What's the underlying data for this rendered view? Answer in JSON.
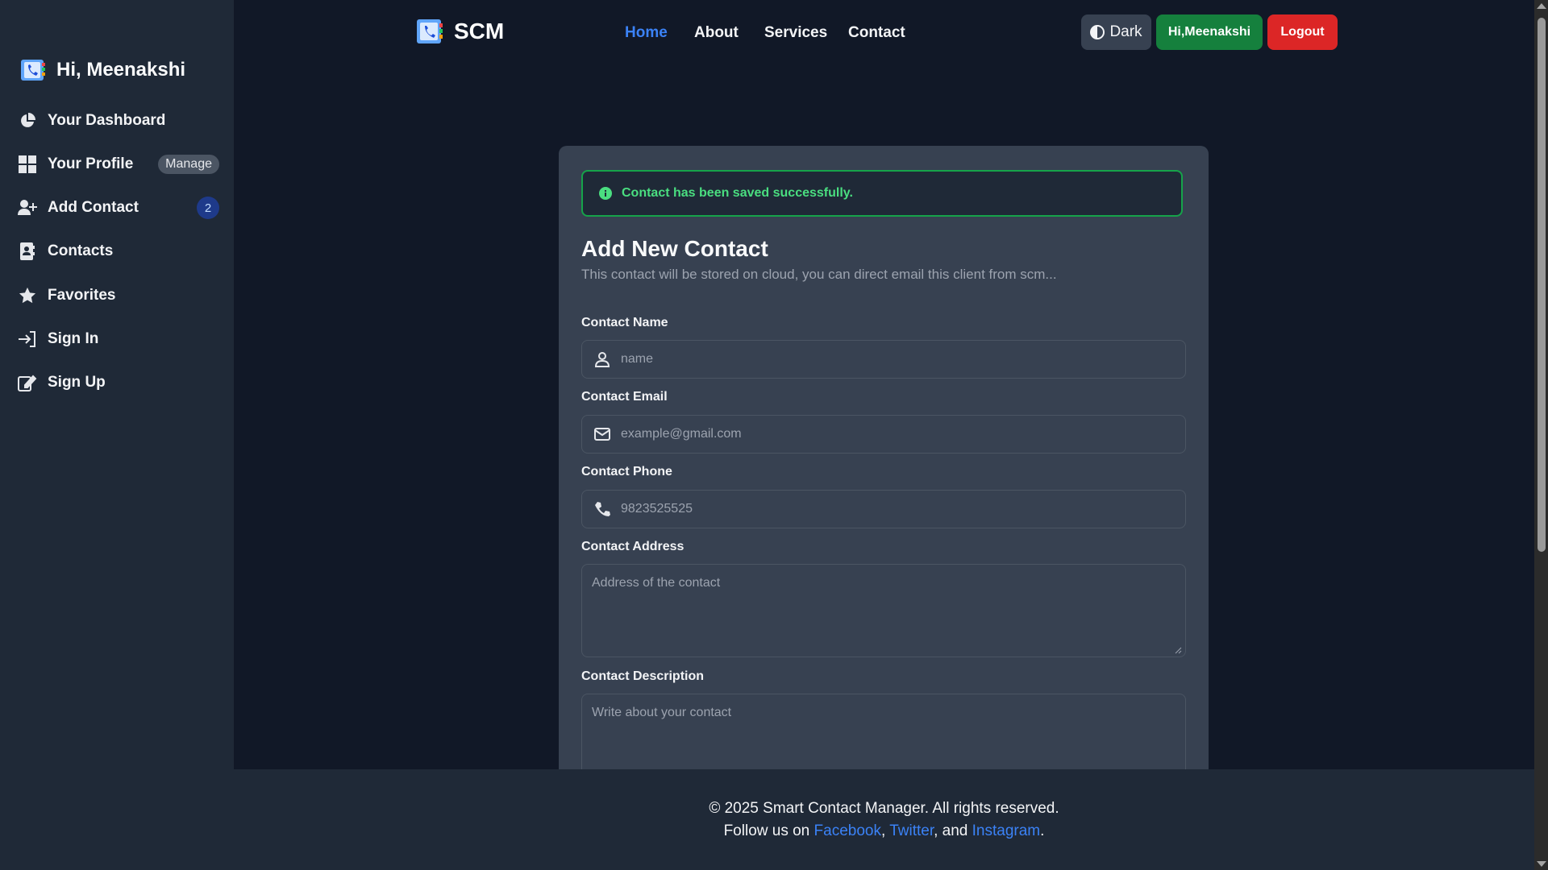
{
  "sidebar": {
    "greeting": "Hi, Meenakshi",
    "items": [
      {
        "label": "Your Dashboard",
        "icon": "chart-pie-icon"
      },
      {
        "label": "Your Profile",
        "icon": "grid-icon",
        "pill": "Manage"
      },
      {
        "label": "Add Contact",
        "icon": "user-plus-icon",
        "count": "2"
      },
      {
        "label": "Contacts",
        "icon": "address-book-icon"
      },
      {
        "label": "Favorites",
        "icon": "star-icon"
      },
      {
        "label": "Sign In",
        "icon": "sign-in-icon"
      },
      {
        "label": "Sign Up",
        "icon": "edit-icon"
      }
    ]
  },
  "navbar": {
    "brand": "SCM",
    "links": [
      {
        "label": "Home",
        "active": true
      },
      {
        "label": "About",
        "active": false
      },
      {
        "label": "Services",
        "active": false
      },
      {
        "label": "Contact",
        "active": false
      }
    ],
    "theme_button": "Dark",
    "user_button": "Hi,Meenakshi",
    "logout_button": "Logout"
  },
  "alert": {
    "message": "Contact has been saved successfully.",
    "icon": "info-circle-icon"
  },
  "form": {
    "title": "Add New Contact",
    "subtitle": "This contact will be stored on cloud, you can direct email this client from scm...",
    "fields": {
      "name": {
        "label": "Contact Name",
        "placeholder": "name",
        "icon": "user-icon"
      },
      "email": {
        "label": "Contact Email",
        "placeholder": "example@gmail.com",
        "icon": "envelope-icon"
      },
      "phone": {
        "label": "Contact Phone",
        "placeholder": "9823525525",
        "icon": "phone-icon"
      },
      "address": {
        "label": "Contact Address",
        "placeholder": "Address of the contact"
      },
      "description": {
        "label": "Contact Description",
        "placeholder": "Write about your contact"
      }
    }
  },
  "footer": {
    "copyright": "© 2025 Smart Contact Manager. All rights reserved.",
    "follow_prefix": "Follow us on ",
    "links": [
      "Facebook",
      "Twitter",
      "Instagram"
    ],
    "sep1": ", ",
    "sep2": ", and ",
    "end": "."
  },
  "colors": {
    "page_bg": "#111827",
    "panel_bg": "#1f2937",
    "card_bg": "#374151",
    "accent": "#3b82f6",
    "success": "#16a34a",
    "danger": "#dc2626"
  }
}
